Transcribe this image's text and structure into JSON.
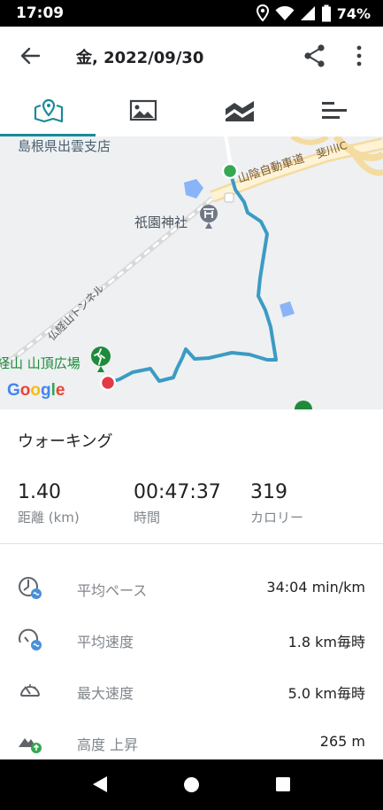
{
  "status_bar": {
    "time": "17:09",
    "battery": "74%",
    "icons": [
      "location-icon",
      "wifi-icon",
      "signal-icon",
      "battery-icon"
    ]
  },
  "app_bar": {
    "title": "金, 2022/09/30",
    "back_icon": "arrow-back-icon",
    "share_icon": "share-icon",
    "more_icon": "more-vert-icon"
  },
  "tabs": {
    "selected": "map",
    "items": [
      "map-icon",
      "photo-icon",
      "chart-icon",
      "laps-icon"
    ],
    "accent": "#1a8a99"
  },
  "map": {
    "labels": {
      "branch": "島根県出雲支店",
      "shrine": "祇園神社",
      "highway": "山陰自動車道",
      "tunnel": "仏経山トンネル",
      "plaza": "経山 山頂広場",
      "route": "斐川IC"
    },
    "google_logo": "Google",
    "route_color": "#3b9bc4",
    "start_color": "#34a853",
    "end_color": "#e53946"
  },
  "activity": {
    "type": "ウォーキング",
    "stats": [
      {
        "value": "1.40",
        "label": "距離 (km)"
      },
      {
        "value": "00:47:37",
        "label": "時間"
      },
      {
        "value": "319",
        "label": "カロリー"
      }
    ]
  },
  "metrics": [
    {
      "icon": "pace-icon",
      "label": "平均ペース",
      "value": "34:04 min/km"
    },
    {
      "icon": "speedometer-avg-icon",
      "label": "平均速度",
      "value": "1.8 km毎時"
    },
    {
      "icon": "speedometer-max-icon",
      "label": "最大速度",
      "value": "5.0 km毎時"
    },
    {
      "icon": "elevation-gain-icon",
      "label": "高度 上昇",
      "value": "265 m"
    }
  ],
  "nav_bar": {
    "icons": [
      "nav-back-icon",
      "nav-home-icon",
      "nav-recents-icon"
    ]
  }
}
